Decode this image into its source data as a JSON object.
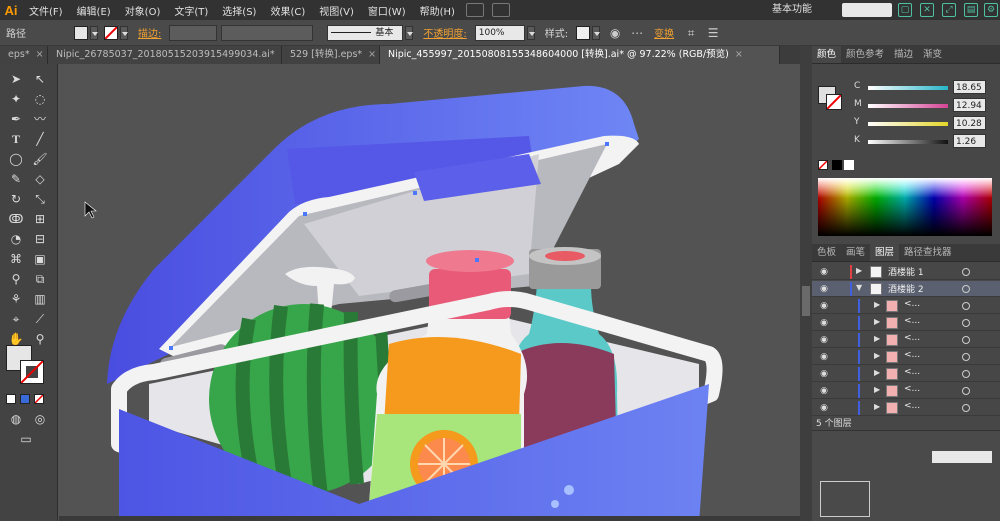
{
  "app": {
    "logo": "Ai",
    "workspace": "基本功能"
  },
  "menu": [
    "文件(F)",
    "编辑(E)",
    "对象(O)",
    "文字(T)",
    "选择(S)",
    "效果(C)",
    "视图(V)",
    "窗口(W)",
    "帮助(H)"
  ],
  "control_bar": {
    "selection_label": "路径",
    "stroke_label": "描边:",
    "brush_label": "基本",
    "opacity_label": "不透明度:",
    "opacity_value": "100%",
    "style_label": "样式:",
    "transform_label": "变换"
  },
  "doc_tabs": [
    {
      "label": "eps*",
      "active": false
    },
    {
      "label": "Nipic_26785037_20180515203915499034.ai*",
      "active": false
    },
    {
      "label": "529 [转换].eps*",
      "active": false
    },
    {
      "label": "Nipic_455997_20150808155348604000 [转换].ai* @ 97.22% (RGB/预览)",
      "active": true
    }
  ],
  "color_panel": {
    "tabs": [
      "颜色",
      "颜色参考",
      "描边",
      "渐变"
    ],
    "channels": [
      {
        "letter": "C",
        "value": "18.65",
        "color": "#27b5c9"
      },
      {
        "letter": "M",
        "value": "12.94",
        "color": "#d54494"
      },
      {
        "letter": "Y",
        "value": "10.28",
        "color": "#e3d62a"
      },
      {
        "letter": "K",
        "value": "1.26",
        "color": "#6a6a6a"
      }
    ]
  },
  "layers_panel": {
    "tabs": [
      "色板",
      "画笔",
      "图层",
      "路径查找器"
    ],
    "layers": [
      {
        "name": "酒楼能 1",
        "level": 0,
        "color": "#e04040"
      },
      {
        "name": "酒楼能 2",
        "level": 0,
        "color": "#4060e0"
      },
      {
        "name": "<...",
        "level": 1,
        "color": "#4060e0"
      },
      {
        "name": "<...",
        "level": 1,
        "color": "#4060e0"
      },
      {
        "name": "<...",
        "level": 1,
        "color": "#4060e0"
      },
      {
        "name": "<...",
        "level": 1,
        "color": "#4060e0"
      },
      {
        "name": "<...",
        "level": 1,
        "color": "#4060e0"
      },
      {
        "name": "<...",
        "level": 1,
        "color": "#4060e0"
      },
      {
        "name": "<...",
        "level": 1,
        "color": "#4060e0"
      }
    ],
    "count_label": "5 个图层"
  },
  "colors": {
    "cooler_blue": "#5a62e8",
    "watermelon": "#2e8a3e",
    "bottle_orange": "#f59a1c",
    "bottle_pink": "#e85a78",
    "bottle_teal": "#5cc9c9"
  }
}
